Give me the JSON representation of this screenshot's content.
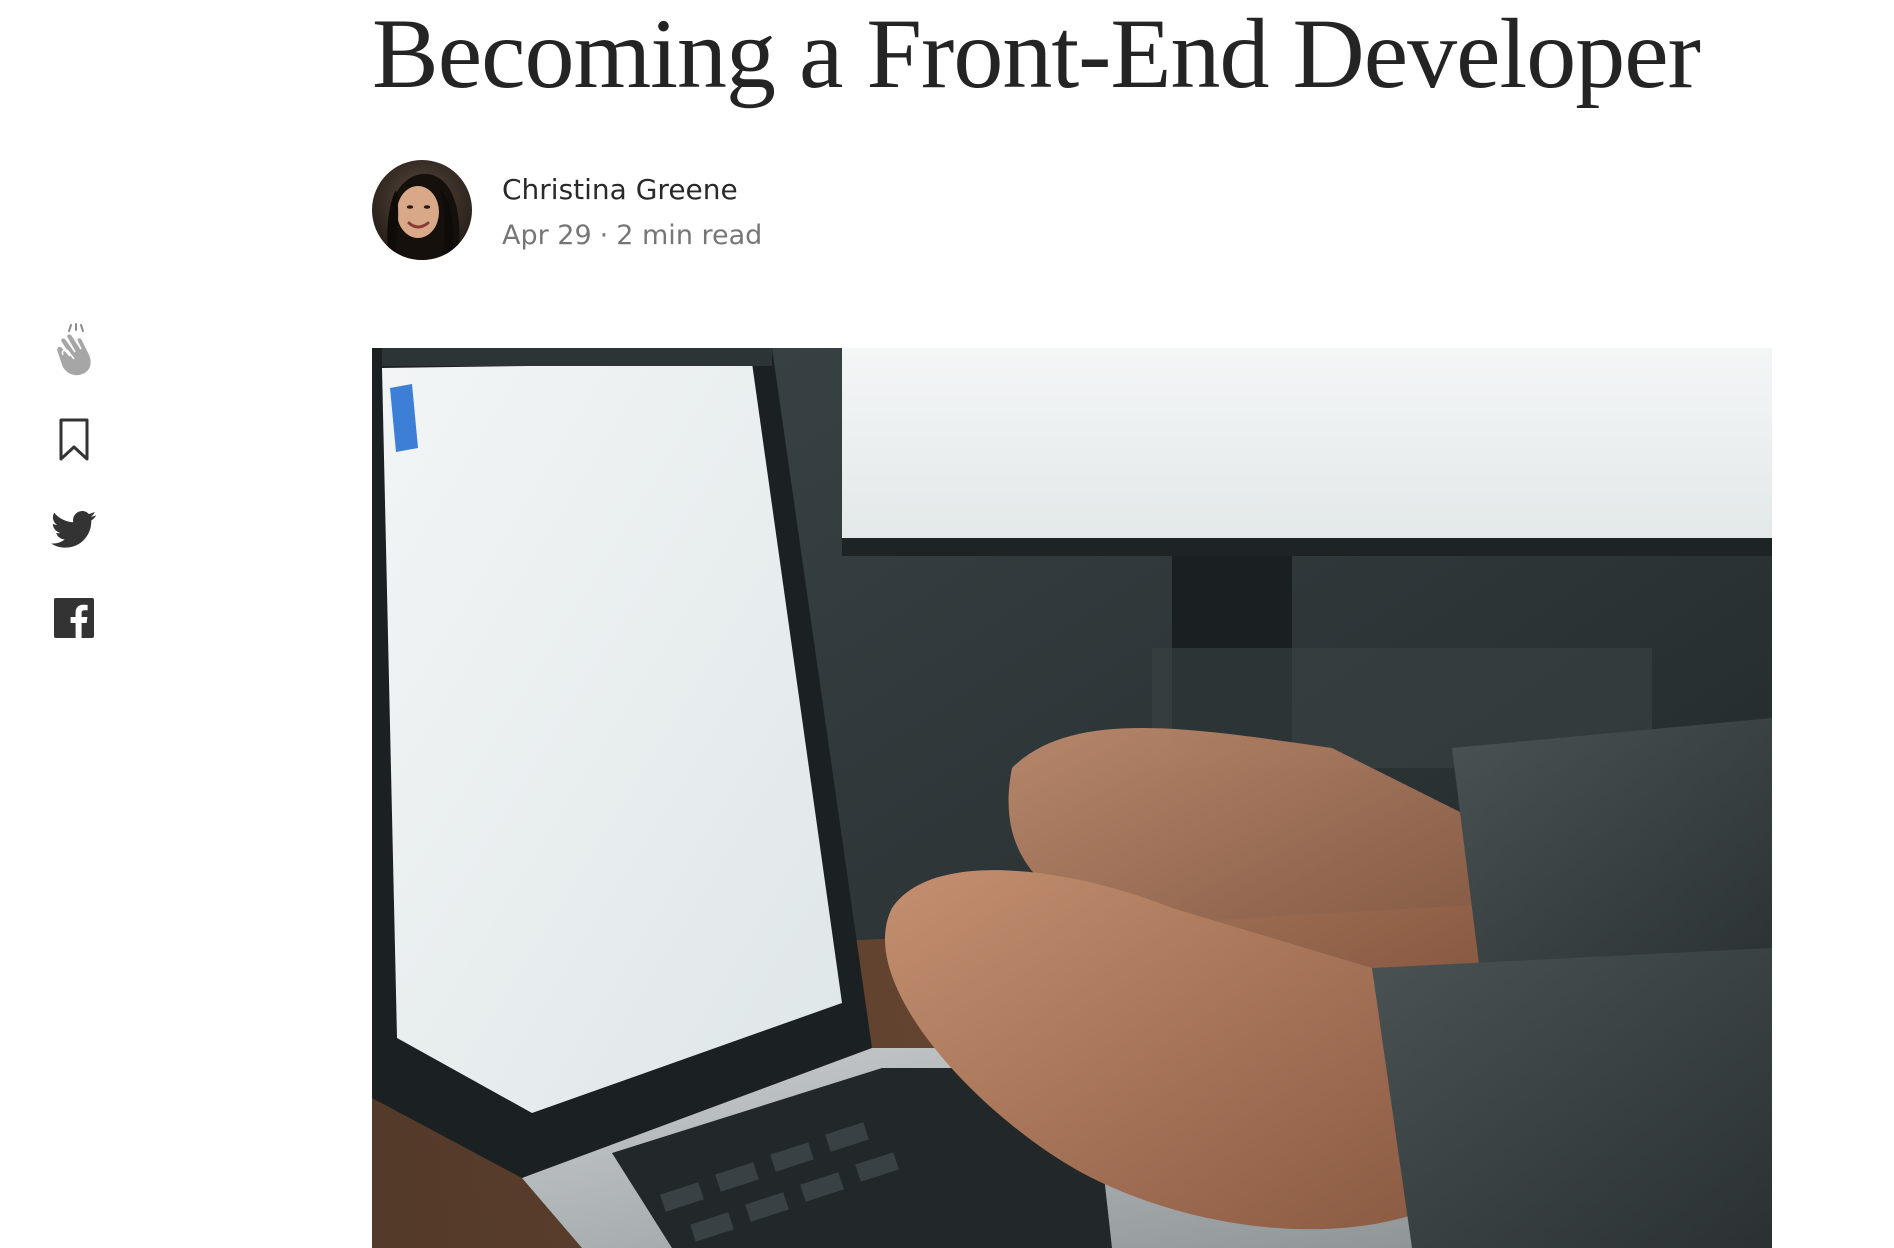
{
  "article": {
    "title": "Becoming a Front-End Developer",
    "author": {
      "name": "Christina Greene",
      "avatar": "author-avatar"
    },
    "meta": {
      "date": "Apr 29",
      "separator": "·",
      "read_time": "2 min read"
    },
    "hero_image": "laptop-typing-photo"
  },
  "share_bar": {
    "items": [
      {
        "icon": "clap-icon",
        "color": "#8c8c8c"
      },
      {
        "icon": "bookmark-icon",
        "color": "#333333"
      },
      {
        "icon": "twitter-icon",
        "color": "#333333"
      },
      {
        "icon": "facebook-icon",
        "color": "#333333"
      }
    ]
  }
}
